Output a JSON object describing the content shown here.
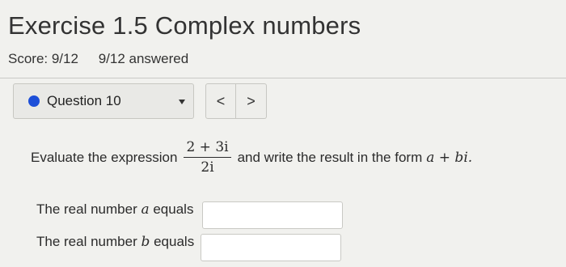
{
  "header": {
    "title": "Exercise 1.5 Complex numbers",
    "score": "Score: 9/12",
    "answered": "9/12 answered"
  },
  "question_nav": {
    "current_label": "Question 10",
    "prev_symbol": "<",
    "next_symbol": ">",
    "status_color": "#1d4fd8"
  },
  "question": {
    "prompt_before": "Evaluate the expression",
    "fraction_numerator": "2 + 3i",
    "fraction_denominator": "2i",
    "prompt_after": "and write the result in the form",
    "form_expression": "a + bi."
  },
  "answers": [
    {
      "label_before": "The real number",
      "variable": "a",
      "label_after": "equals",
      "value": ""
    },
    {
      "label_before": "The real number",
      "variable": "b",
      "label_after": "equals",
      "value": ""
    }
  ]
}
